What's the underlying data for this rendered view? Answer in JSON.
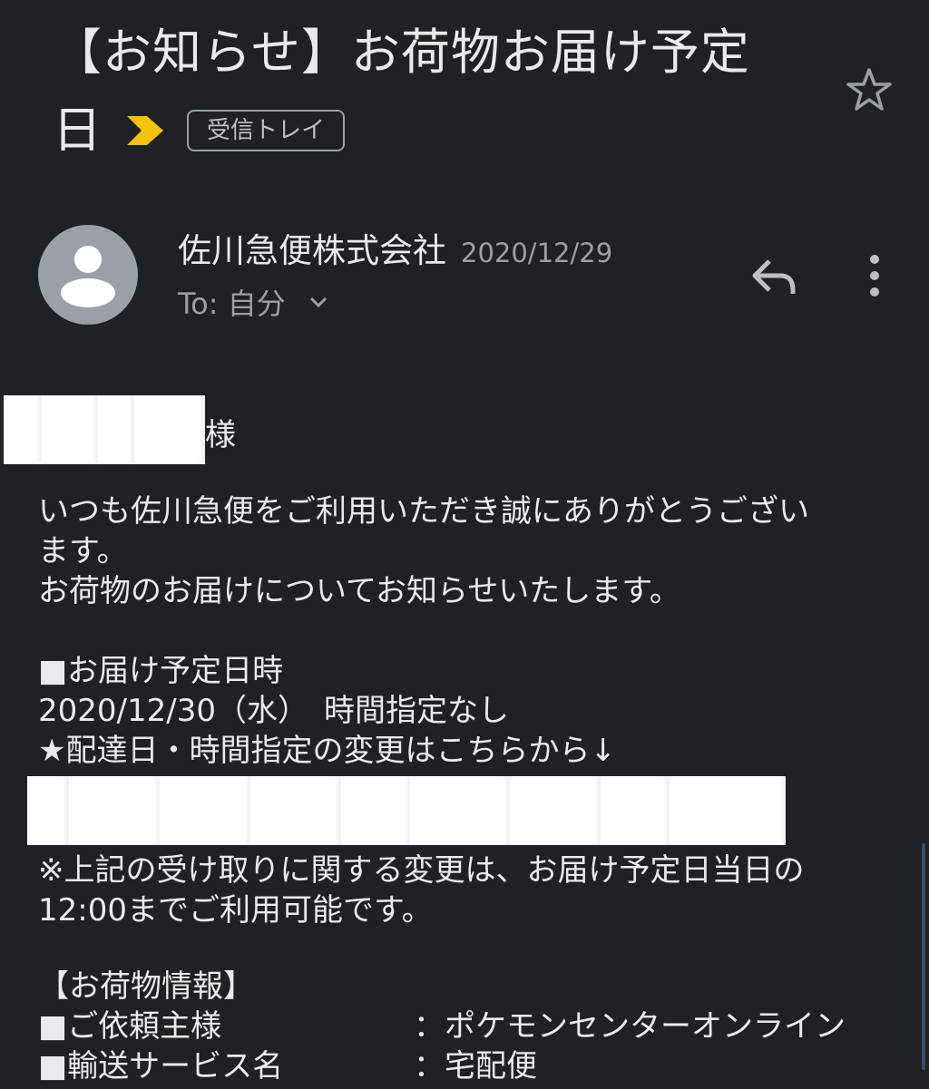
{
  "email": {
    "subject_line1": "【お知らせ】お荷物お届け予定",
    "subject_line2": "日",
    "label": "受信トレイ",
    "sender_name": "佐川急便株式会社",
    "date": "2020/12/29",
    "to_label": "To: 自分"
  },
  "icons": {
    "importance": "importance-marker-icon",
    "star": "star-icon",
    "avatar": "person-avatar-icon",
    "reply": "reply-icon",
    "more": "more-vert-icon",
    "expand": "chevron-down-icon"
  },
  "colors": {
    "background": "#202124",
    "text": "#e8eaed",
    "muted": "#9aa0a6",
    "importance": "#f4c20d"
  },
  "body": {
    "salutation_suffix": "様",
    "para1_line1": "いつも佐川急便をご利用いただき誠にありがとうござい",
    "para1_line2": "ます。",
    "para1_line3": "お荷物のお届けについてお知らせいたします。",
    "delivery_heading": "■お届け予定日時",
    "delivery_datetime": "2020/12/30（水）　時間指定なし",
    "change_note": "★配達日・時間指定の変更はこちらから↓",
    "notice_line1": "※上記の受け取りに関する変更は、お届け予定日当日の",
    "notice_line2": "12:00までご利用可能です。",
    "info_heading": "【お荷物情報】",
    "info_rows": [
      {
        "key": "■ご依頼主様",
        "value": "：ポケモンセンターオンライン"
      },
      {
        "key": "■輸送サービス名",
        "value": "：宅配便"
      }
    ]
  }
}
